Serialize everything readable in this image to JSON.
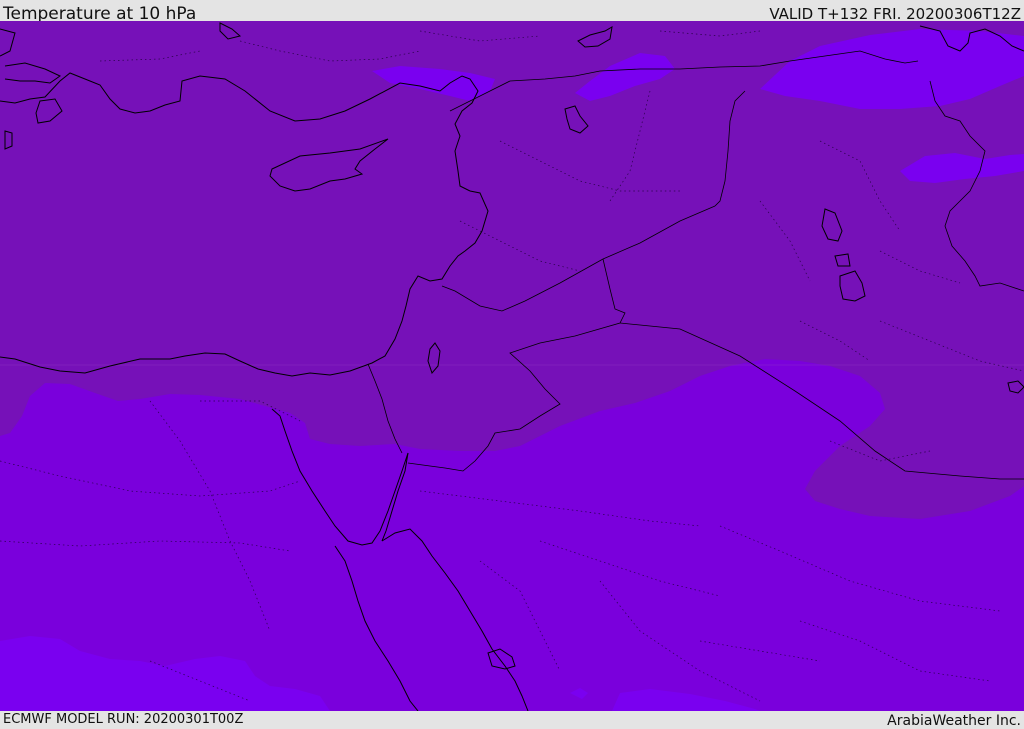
{
  "header": {
    "title": "Temperature at 10 hPa",
    "valid": "VALID T+132 FRI. 20200306T12Z"
  },
  "footer": {
    "model_run": "ECMWF MODEL RUN: 20200301T00Z",
    "credit": "ArabiaWeather Inc."
  },
  "map": {
    "colors": {
      "warm_band": "#7611b8",
      "mid_band": "#7a00dc",
      "cold_band": "#7a00f0",
      "coastline": "#000000"
    }
  }
}
